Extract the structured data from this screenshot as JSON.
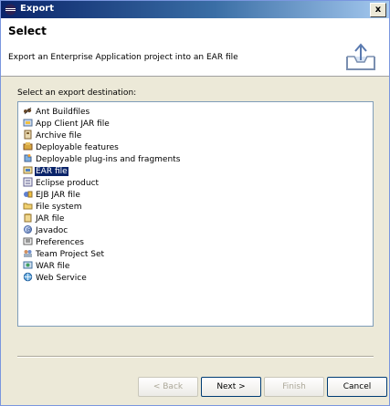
{
  "window": {
    "title": "Export",
    "close_label": "x"
  },
  "header": {
    "title": "Select",
    "description": "Export an Enterprise Application project into an EAR file"
  },
  "list": {
    "label": "Select an export destination:",
    "items": [
      {
        "label": "Ant Buildfiles",
        "icon": "ant-icon"
      },
      {
        "label": "App Client JAR file",
        "icon": "app-client-jar-icon"
      },
      {
        "label": "Archive file",
        "icon": "archive-icon"
      },
      {
        "label": "Deployable features",
        "icon": "feature-icon"
      },
      {
        "label": "Deployable plug-ins and fragments",
        "icon": "plugin-icon"
      },
      {
        "label": "EAR file",
        "icon": "ear-icon",
        "selected": true
      },
      {
        "label": "Eclipse product",
        "icon": "eclipse-product-icon"
      },
      {
        "label": "EJB JAR file",
        "icon": "ejb-jar-icon"
      },
      {
        "label": "File system",
        "icon": "folder-icon"
      },
      {
        "label": "JAR file",
        "icon": "jar-icon"
      },
      {
        "label": "Javadoc",
        "icon": "javadoc-icon"
      },
      {
        "label": "Preferences",
        "icon": "preferences-icon"
      },
      {
        "label": "Team Project Set",
        "icon": "team-icon"
      },
      {
        "label": "WAR file",
        "icon": "war-icon"
      },
      {
        "label": "Web Service",
        "icon": "web-service-icon"
      }
    ]
  },
  "buttons": {
    "back": "< Back",
    "next": "Next >",
    "finish": "Finish",
    "cancel": "Cancel"
  },
  "colors": {
    "selection": "#0a246a",
    "titlebar": "#0a246a"
  }
}
